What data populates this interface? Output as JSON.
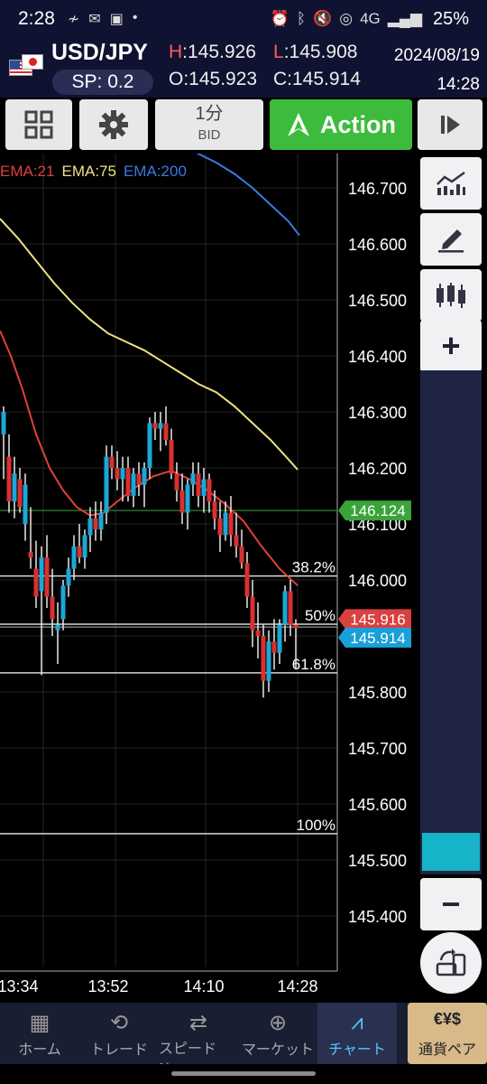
{
  "status_bar": {
    "time": "2:28",
    "network": "4G",
    "battery": "25%"
  },
  "header": {
    "pair": "USD/JPY",
    "spread": "SP: 0.2",
    "high_label": "H",
    "high": ":145.926",
    "low_label": "L",
    "low": ":145.908",
    "open": "O:145.923",
    "close": "C:145.914",
    "date": "2024/08/19",
    "time": "14:28"
  },
  "toolbar": {
    "timeframe": "1分",
    "price_type": "BID",
    "action_label": "Action"
  },
  "chart_data": {
    "type": "candlestick",
    "y_ticks": [
      "146.700",
      "146.600",
      "146.500",
      "146.400",
      "146.300",
      "146.200",
      "146.100",
      "146.000",
      "145.900",
      "145.800",
      "145.700",
      "145.600",
      "145.500",
      "145.400"
    ],
    "x_ticks": [
      "13:34",
      "13:52",
      "14:10",
      "14:28"
    ],
    "ema_legend": [
      {
        "label": "EMA:21",
        "color": "#e0403a"
      },
      {
        "label": "EMA:75",
        "color": "#f0e080"
      },
      {
        "label": "EMA:200",
        "color": "#3a7ae0"
      }
    ],
    "fib_levels": [
      {
        "label": "38.2%",
        "price": 146.007
      },
      {
        "label": "50%",
        "price": 145.921
      },
      {
        "label": "61.8%",
        "price": 145.834
      },
      {
        "label": "100%",
        "price": 145.547
      }
    ],
    "price_labels": [
      {
        "text": "146.124",
        "color": "#3aa33a"
      },
      {
        "text": "145.916",
        "color": "#d94040"
      },
      {
        "text": "145.914",
        "color": "#1aa0d8"
      }
    ],
    "colors": {
      "up": "#1aa8d8",
      "down": "#d93030",
      "ema21": "#e0403a",
      "ema75": "#f0e080",
      "ema200": "#3a7ae0"
    }
  },
  "nav": [
    {
      "label": "ホーム",
      "icon": "home-grid-icon"
    },
    {
      "label": "トレード",
      "icon": "refresh-icon"
    },
    {
      "label": "スピード注...",
      "icon": "speed-icon"
    },
    {
      "label": "マーケット",
      "icon": "globe-icon"
    },
    {
      "label": "チャート",
      "icon": "chart-icon"
    },
    {
      "label": "通貨ペア",
      "icon": "currency-icon"
    }
  ]
}
